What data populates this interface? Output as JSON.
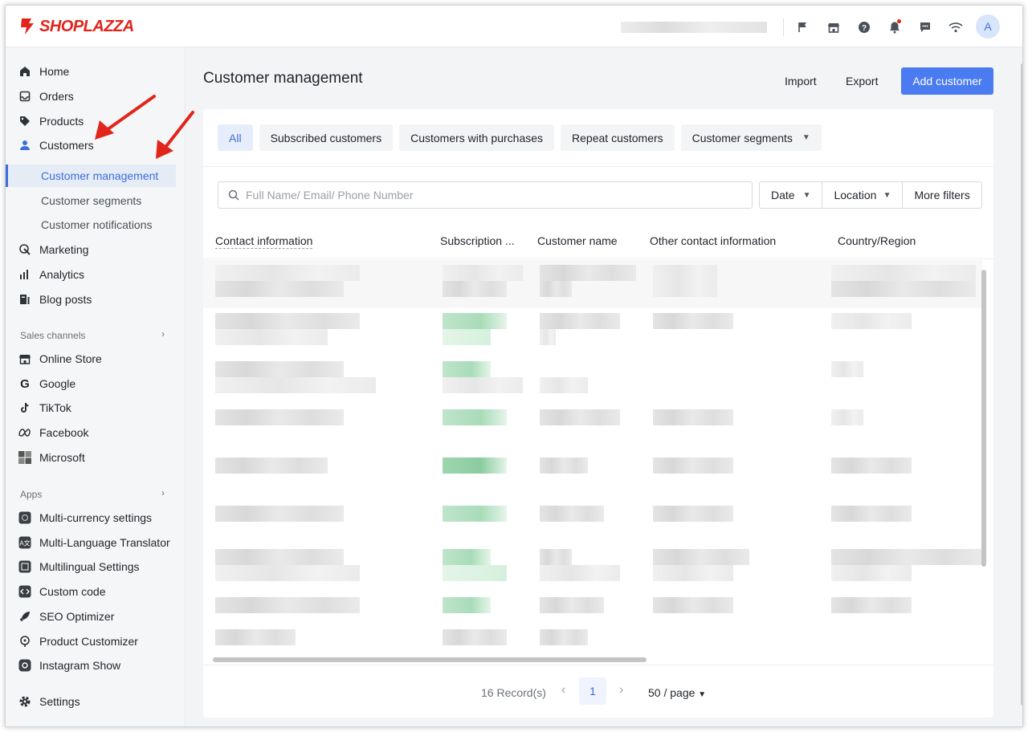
{
  "brand": {
    "name": "SHOPLAZZA",
    "color": "#e1251b"
  },
  "header": {
    "icons": [
      "flag-icon",
      "store-icon",
      "help-icon",
      "bell-icon",
      "chat-icon",
      "wifi-icon"
    ],
    "avatar_initial": "A"
  },
  "sidebar": {
    "items": [
      {
        "label": "Home",
        "icon": "home-icon"
      },
      {
        "label": "Orders",
        "icon": "orders-icon"
      },
      {
        "label": "Products",
        "icon": "tag-icon"
      },
      {
        "label": "Customers",
        "icon": "person-icon"
      }
    ],
    "customer_sub": [
      {
        "label": "Customer management",
        "active": true
      },
      {
        "label": "Customer segments",
        "active": false
      },
      {
        "label": "Customer notifications",
        "active": false
      }
    ],
    "items2": [
      {
        "label": "Marketing",
        "icon": "marketing-icon"
      },
      {
        "label": "Analytics",
        "icon": "analytics-icon"
      },
      {
        "label": "Blog posts",
        "icon": "blog-icon"
      }
    ],
    "sales_channels_label": "Sales channels",
    "channels": [
      {
        "label": "Online Store",
        "icon": "store-icon"
      },
      {
        "label": "Google",
        "icon": "google-icon"
      },
      {
        "label": "TikTok",
        "icon": "tiktok-icon"
      },
      {
        "label": "Facebook",
        "icon": "meta-icon"
      },
      {
        "label": "Microsoft",
        "icon": "microsoft-icon"
      }
    ],
    "apps_label": "Apps",
    "apps": [
      {
        "label": "Multi-currency settings",
        "icon": "currency-icon"
      },
      {
        "label": "Multi-Language Translator",
        "icon": "translate-icon"
      },
      {
        "label": "Multilingual Settings",
        "icon": "language-icon"
      },
      {
        "label": "Custom code",
        "icon": "code-icon"
      },
      {
        "label": "SEO Optimizer",
        "icon": "rocket-icon"
      },
      {
        "label": "Product Customizer",
        "icon": "palette-icon"
      },
      {
        "label": "Instagram Show",
        "icon": "instagram-icon"
      }
    ],
    "settings_label": "Settings"
  },
  "main": {
    "title": "Customer management",
    "import_label": "Import",
    "export_label": "Export",
    "add_label": "Add customer",
    "tabs": [
      {
        "label": "All",
        "active": true
      },
      {
        "label": "Subscribed customers",
        "active": false
      },
      {
        "label": "Customers with purchases",
        "active": false
      },
      {
        "label": "Repeat customers",
        "active": false
      },
      {
        "label": "Customer segments",
        "active": false,
        "dropdown": true
      }
    ],
    "search_placeholder": "Full Name/ Email/ Phone Number",
    "filters": [
      "Date",
      "Location",
      "More filters"
    ],
    "columns": [
      "Contact information",
      "Subscription ...",
      "Customer name",
      "Other contact information",
      "Country/Region"
    ],
    "records": "16 Record(s)",
    "current_page": "1",
    "per_page": "50 / page"
  },
  "colors": {
    "accent": "#4a7bf0",
    "active_bg": "#e6ecf6",
    "subscribed_green": "#a9dcb9"
  }
}
